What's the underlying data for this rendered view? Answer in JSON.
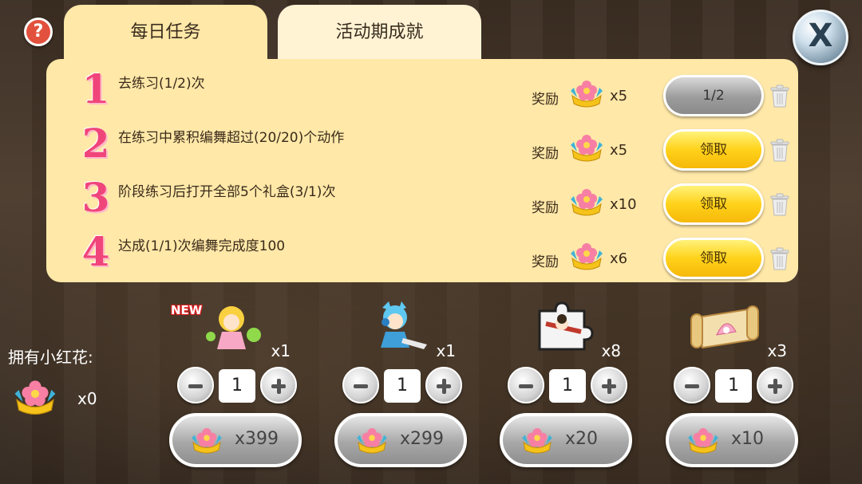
{
  "help_label": "?",
  "close_label": "X",
  "tabs": [
    {
      "label": "每日任务",
      "active": true
    },
    {
      "label": "活动期成就",
      "active": false
    }
  ],
  "tasks": [
    {
      "num": "1",
      "text": "去练习(1/2)次",
      "reward_label": "奖励",
      "reward_qty": "x5",
      "button": "1/2",
      "button_state": "disabled"
    },
    {
      "num": "2",
      "text": "在练习中累积编舞超过(20/20)个动作",
      "reward_label": "奖励",
      "reward_qty": "x5",
      "button": "领取",
      "button_state": "claimable"
    },
    {
      "num": "3",
      "text": "阶段练习后打开全部5个礼盒(3/1)次",
      "reward_label": "奖励",
      "reward_qty": "x10",
      "button": "领取",
      "button_state": "claimable"
    },
    {
      "num": "4",
      "text": "达成(1/1)次编舞完成度100",
      "reward_label": "奖励",
      "reward_qty": "x6",
      "button": "领取",
      "button_state": "claimable"
    }
  ],
  "owned": {
    "label": "拥有小红花:",
    "qty": "x0"
  },
  "shop_items": [
    {
      "name": "dancer-girl-item",
      "badge": "NEW",
      "qty": "x1",
      "stepper": "1",
      "price": "x399"
    },
    {
      "name": "cat-ear-boy-item",
      "badge": "",
      "qty": "x1",
      "stepper": "1",
      "price": "x299"
    },
    {
      "name": "puzzle-piece-item",
      "badge": "",
      "qty": "x8",
      "stepper": "1",
      "price": "x20"
    },
    {
      "name": "treasure-scroll-item",
      "badge": "",
      "qty": "x3",
      "stepper": "1",
      "price": "x10"
    }
  ],
  "colors": {
    "accent_gold": "#ffd21a",
    "panel": "#ffe8a8",
    "task_number": "#f0457a"
  },
  "icons": [
    "help-icon",
    "close-icon",
    "flower-reward-icon",
    "trash-icon",
    "minus-icon",
    "plus-icon"
  ]
}
